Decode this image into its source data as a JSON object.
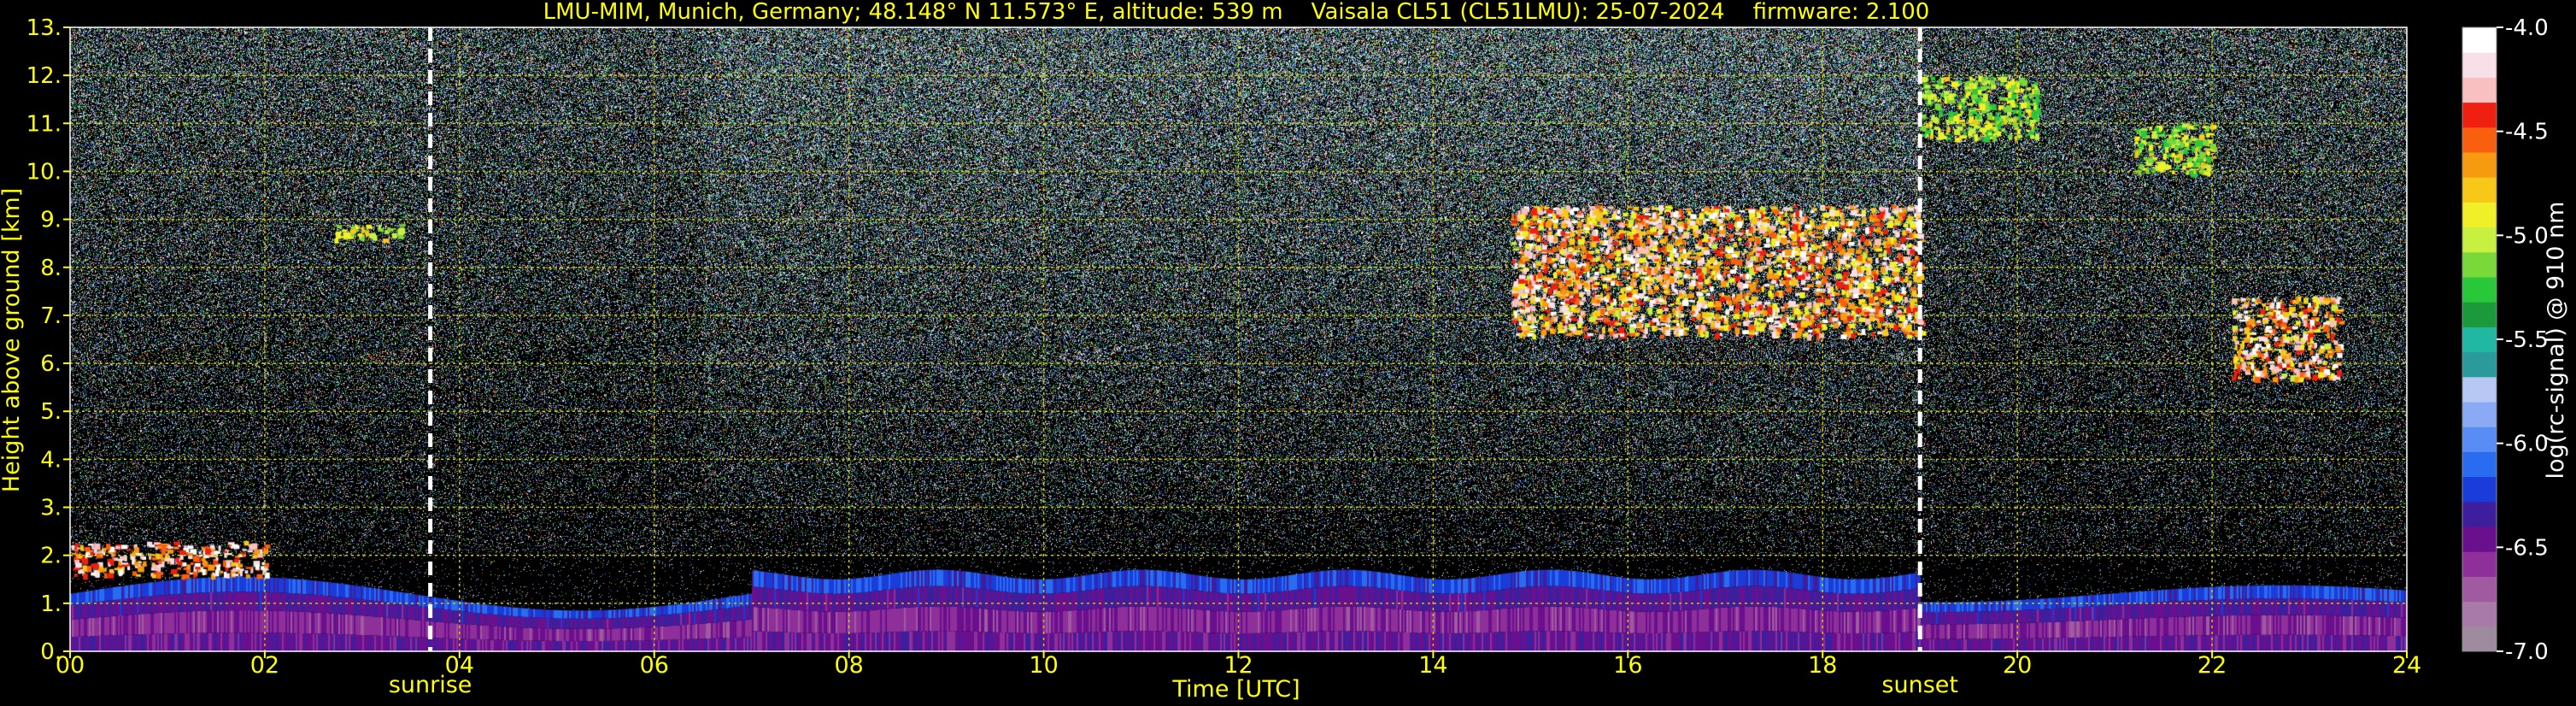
{
  "chart_data": {
    "type": "heatmap",
    "title": "LMU-MIM, Munich, Germany; 48.148° N 11.573° E, altitude: 539 m    Vaisala CL51 (CL51LMU): 25-07-2024    firmware: 2.100",
    "xlabel": "Time [UTC]",
    "ylabel": "Height above ground [km]",
    "xlim": [
      0,
      24
    ],
    "ylim": [
      0,
      13
    ],
    "x_ticks": [
      0,
      2,
      4,
      6,
      8,
      10,
      12,
      14,
      16,
      18,
      20,
      22,
      24
    ],
    "x_tick_labels": [
      "00",
      "02",
      "04",
      "06",
      "08",
      "10",
      "12",
      "14",
      "16",
      "18",
      "20",
      "22",
      "24"
    ],
    "y_ticks": [
      0,
      1,
      2,
      3,
      4,
      5,
      6,
      7,
      8,
      9,
      10,
      11,
      12,
      13
    ],
    "y_tick_labels": [
      "0.",
      "1.",
      "2.",
      "3.",
      "4.",
      "5.",
      "6.",
      "7.",
      "8.",
      "9.",
      "10.",
      "11.",
      "12.",
      "13."
    ],
    "grid": true,
    "grid_color": "#c8c800",
    "text_color": "#ffff00",
    "events": [
      {
        "name": "sunrise",
        "time": 3.7
      },
      {
        "name": "sunset",
        "time": 19.0
      }
    ],
    "colorbar": {
      "label": "log(rc-signal) @ 910 nm",
      "range": [
        -7.0,
        -4.0
      ],
      "ticks": [
        -7.0,
        -6.5,
        -6.0,
        -5.5,
        -5.0,
        -4.5,
        -4.0
      ],
      "tick_labels": [
        "-7.0",
        "-6.5",
        "-6.0",
        "-5.5",
        "-5.0",
        "-4.5",
        "-4.0"
      ],
      "colors": [
        "#9e8c9e",
        "#a87aa8",
        "#a05aa0",
        "#8e2f9a",
        "#6a0f8e",
        "#3d1f9e",
        "#1a3cd8",
        "#2a6cf0",
        "#5a8cf5",
        "#8aaaf5",
        "#b8c8f5",
        "#2a9a9a",
        "#20b8a0",
        "#1a9a3a",
        "#28c83a",
        "#7ad83a",
        "#c8f040",
        "#f0f028",
        "#f8c818",
        "#f89a10",
        "#f86010",
        "#f02010",
        "#f8c0c0",
        "#f8e0e8",
        "#ffffff"
      ]
    },
    "features": [
      {
        "kind": "boundary_layer",
        "t_start": 0,
        "t_end": 24,
        "top_km": 1.2,
        "signal_range": [
          -6.6,
          -6.0
        ]
      },
      {
        "kind": "cloud",
        "t_start": 0.0,
        "t_end": 2.0,
        "height_km": [
          1.6,
          2.3
        ],
        "signal_range": [
          -4.8,
          -4.0
        ]
      },
      {
        "kind": "cloud",
        "t_start": 2.7,
        "t_end": 3.4,
        "height_km": [
          8.6,
          8.9
        ],
        "signal_range": [
          -5.2,
          -4.8
        ]
      },
      {
        "kind": "cloud",
        "t_start": 14.8,
        "t_end": 19.0,
        "height_km": [
          6.6,
          9.3
        ],
        "signal_range": [
          -5.0,
          -4.0
        ]
      },
      {
        "kind": "cloud",
        "t_start": 19.0,
        "t_end": 20.2,
        "height_km": [
          10.7,
          12.0
        ],
        "signal_range": [
          -5.3,
          -4.8
        ]
      },
      {
        "kind": "cloud",
        "t_start": 21.2,
        "t_end": 22.0,
        "height_km": [
          10.0,
          11.0
        ],
        "signal_range": [
          -5.3,
          -4.8
        ]
      },
      {
        "kind": "cloud",
        "t_start": 22.2,
        "t_end": 23.3,
        "height_km": [
          5.7,
          7.4
        ],
        "signal_range": [
          -5.0,
          -4.0
        ]
      }
    ]
  }
}
